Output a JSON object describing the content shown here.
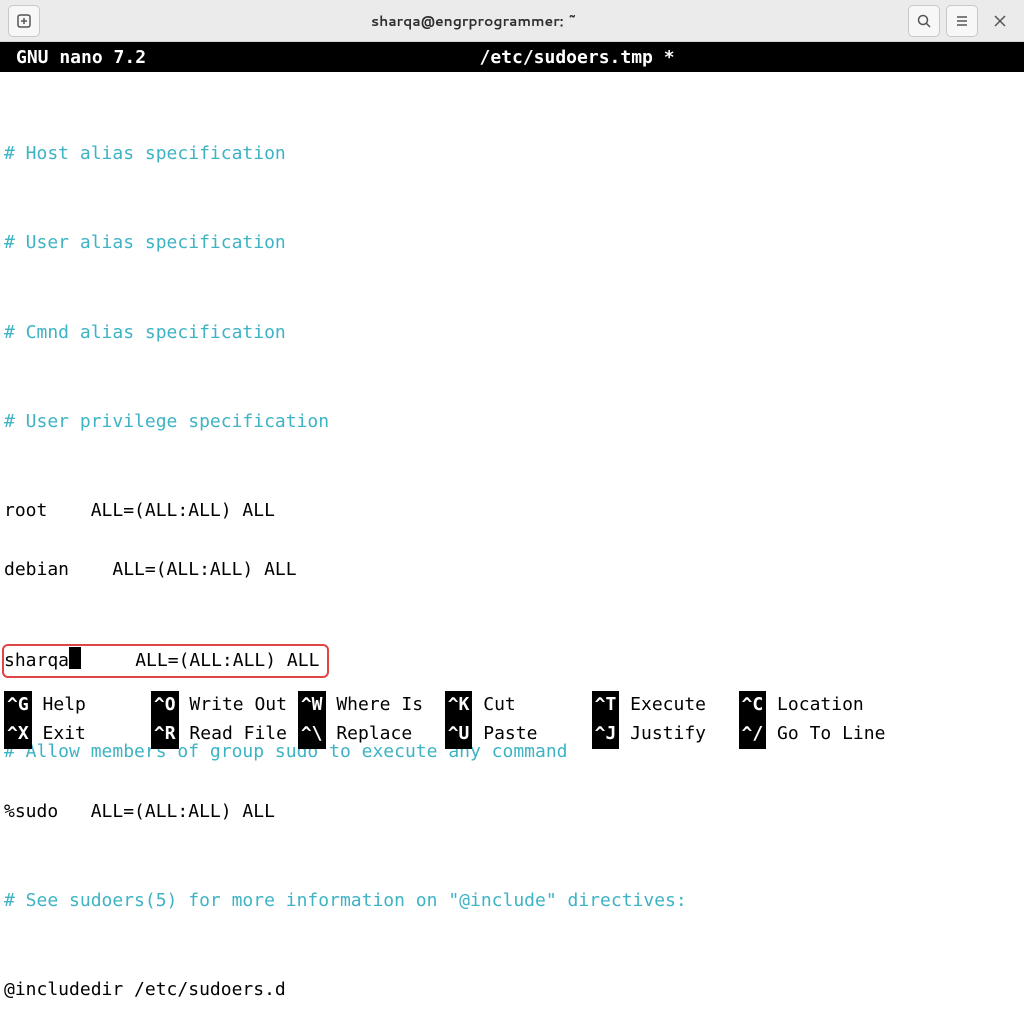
{
  "titlebar": {
    "title": "sharqa@engrprogrammer: ~"
  },
  "nano": {
    "app": "GNU nano 7.2",
    "file": "/etc/sudoers.tmp *"
  },
  "content": {
    "comments": {
      "host_alias": "# Host alias specification",
      "user_alias": "# User alias specification",
      "cmnd_alias": "# Cmnd alias specification",
      "user_priv": "# User privilege specification",
      "allow_sudo": "# Allow members of group sudo to execute any command",
      "see_sudoers": "# See sudoers(5) for more information on \"@include\" directives:"
    },
    "lines": {
      "root": "root    ALL=(ALL:ALL) ALL",
      "debian": "debian    ALL=(ALL:ALL) ALL",
      "sharqa_user": "sharqa",
      "sharqa_rest": "     ALL=(ALL:ALL) ALL",
      "sudo_group": "%sudo   ALL=(ALL:ALL) ALL",
      "includedir": "@includedir /etc/sudoers.d"
    }
  },
  "shortcuts": {
    "row1": [
      {
        "key": "^G",
        "label": " Help      "
      },
      {
        "key": "^O",
        "label": " Write Out "
      },
      {
        "key": "^W",
        "label": " Where Is  "
      },
      {
        "key": "^K",
        "label": " Cut       "
      },
      {
        "key": "^T",
        "label": " Execute   "
      },
      {
        "key": "^C",
        "label": " Location"
      }
    ],
    "row2": [
      {
        "key": "^X",
        "label": " Exit      "
      },
      {
        "key": "^R",
        "label": " Read File "
      },
      {
        "key": "^\\",
        "label": " Replace   "
      },
      {
        "key": "^U",
        "label": " Paste     "
      },
      {
        "key": "^J",
        "label": " Justify   "
      },
      {
        "key": "^/",
        "label": " Go To Line"
      }
    ]
  }
}
